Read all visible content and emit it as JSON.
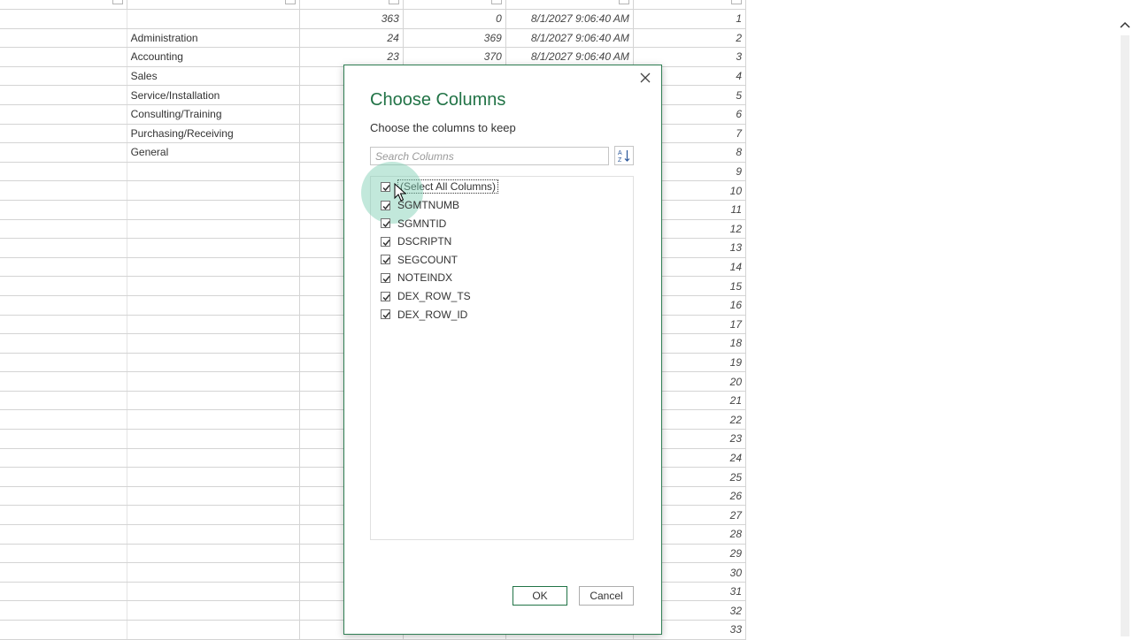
{
  "grid": {
    "rows": [
      {
        "name": "",
        "num1": "363",
        "num2": "0",
        "date": "8/1/2027 9:06:40 AM",
        "id": "1"
      },
      {
        "name": "Administration",
        "num1": "24",
        "num2": "369",
        "date": "8/1/2027 9:06:40 AM",
        "id": "2"
      },
      {
        "name": "Accounting",
        "num1": "23",
        "num2": "370",
        "date": "8/1/2027 9:06:40 AM",
        "id": "3"
      },
      {
        "name": "Sales",
        "num1": "",
        "num2": "",
        "date": "",
        "id": "4"
      },
      {
        "name": "Service/Installation",
        "num1": "",
        "num2": "",
        "date": "",
        "id": "5"
      },
      {
        "name": "Consulting/Training",
        "num1": "",
        "num2": "",
        "date": "",
        "id": "6"
      },
      {
        "name": "Purchasing/Receiving",
        "num1": "",
        "num2": "",
        "date": "",
        "id": "7"
      },
      {
        "name": "General",
        "num1": "",
        "num2": "",
        "date": "",
        "id": "8"
      },
      {
        "name": "",
        "num1": "",
        "num2": "",
        "date": "",
        "id": "9"
      },
      {
        "name": "",
        "num1": "",
        "num2": "",
        "date": "",
        "id": "10"
      },
      {
        "name": "",
        "num1": "",
        "num2": "",
        "date": "",
        "id": "11"
      },
      {
        "name": "",
        "num1": "",
        "num2": "",
        "date": "",
        "id": "12"
      },
      {
        "name": "",
        "num1": "",
        "num2": "",
        "date": "",
        "id": "13"
      },
      {
        "name": "",
        "num1": "",
        "num2": "",
        "date": "",
        "id": "14"
      },
      {
        "name": "",
        "num1": "",
        "num2": "",
        "date": "",
        "id": "15"
      },
      {
        "name": "",
        "num1": "",
        "num2": "",
        "date": "",
        "id": "16"
      },
      {
        "name": "",
        "num1": "",
        "num2": "",
        "date": "",
        "id": "17"
      },
      {
        "name": "",
        "num1": "",
        "num2": "",
        "date": "",
        "id": "18"
      },
      {
        "name": "",
        "num1": "",
        "num2": "",
        "date": "",
        "id": "19"
      },
      {
        "name": "",
        "num1": "",
        "num2": "",
        "date": "",
        "id": "20"
      },
      {
        "name": "",
        "num1": "",
        "num2": "",
        "date": "",
        "id": "21"
      },
      {
        "name": "",
        "num1": "",
        "num2": "",
        "date": "",
        "id": "22"
      },
      {
        "name": "",
        "num1": "",
        "num2": "",
        "date": "",
        "id": "23"
      },
      {
        "name": "",
        "num1": "",
        "num2": "",
        "date": "",
        "id": "24"
      },
      {
        "name": "",
        "num1": "",
        "num2": "",
        "date": "",
        "id": "25"
      },
      {
        "name": "",
        "num1": "",
        "num2": "",
        "date": "",
        "id": "26"
      },
      {
        "name": "",
        "num1": "",
        "num2": "",
        "date": "",
        "id": "27"
      },
      {
        "name": "",
        "num1": "",
        "num2": "",
        "date": "",
        "id": "28"
      },
      {
        "name": "",
        "num1": "",
        "num2": "",
        "date": "",
        "id": "29"
      },
      {
        "name": "",
        "num1": "",
        "num2": "",
        "date": "",
        "id": "30"
      },
      {
        "name": "",
        "num1": "",
        "num2": "",
        "date": "",
        "id": "31"
      },
      {
        "name": "",
        "num1": "",
        "num2": "",
        "date": "",
        "id": "32"
      },
      {
        "name": "",
        "num1": "",
        "num2": "",
        "date": "",
        "id": "33"
      }
    ]
  },
  "dialog": {
    "title": "Choose Columns",
    "subtitle": "Choose the columns to keep",
    "search_placeholder": "Search Columns",
    "sort_icon": "sort-az-icon",
    "close_icon": "close-icon",
    "select_all_label": "(Select All Columns)",
    "select_all_checked": true,
    "columns": [
      {
        "label": "SGMTNUMB",
        "checked": true
      },
      {
        "label": "SGMNTID",
        "checked": true
      },
      {
        "label": "DSCRIPTN",
        "checked": true
      },
      {
        "label": "SEGCOUNT",
        "checked": true
      },
      {
        "label": "NOTEINDX",
        "checked": true
      },
      {
        "label": "DEX_ROW_TS",
        "checked": true
      },
      {
        "label": "DEX_ROW_ID",
        "checked": true
      }
    ],
    "ok_label": "OK",
    "cancel_label": "Cancel"
  },
  "colors": {
    "accent": "#217346",
    "grid_border": "#d4d4d4",
    "highlight": "#78cdaf"
  }
}
